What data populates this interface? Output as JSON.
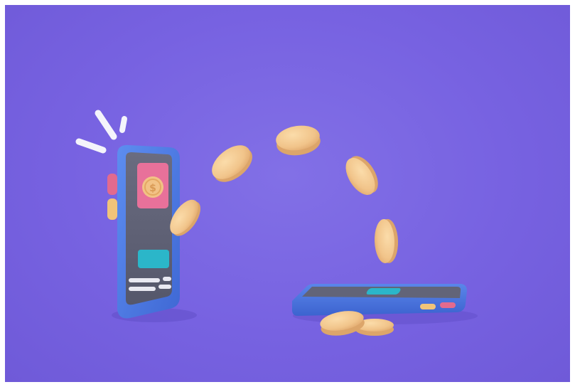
{
  "scene": {
    "description_icons": [
      "phone-upright-icon",
      "phone-lying-icon",
      "coin-icon",
      "sparkle-lines-icon"
    ],
    "colors": {
      "background": "#7664e0",
      "phone_body": "#4f7de6",
      "phone_screen": "#5f6175",
      "coin_face": "#f3c98e",
      "coin_edge": "#dca56a",
      "pink_button": "#e8719a",
      "teal_button": "#2bb6c9",
      "side_button_pink": "#e26a8e",
      "side_button_yellow": "#f0c479"
    },
    "coin_count": 8
  }
}
